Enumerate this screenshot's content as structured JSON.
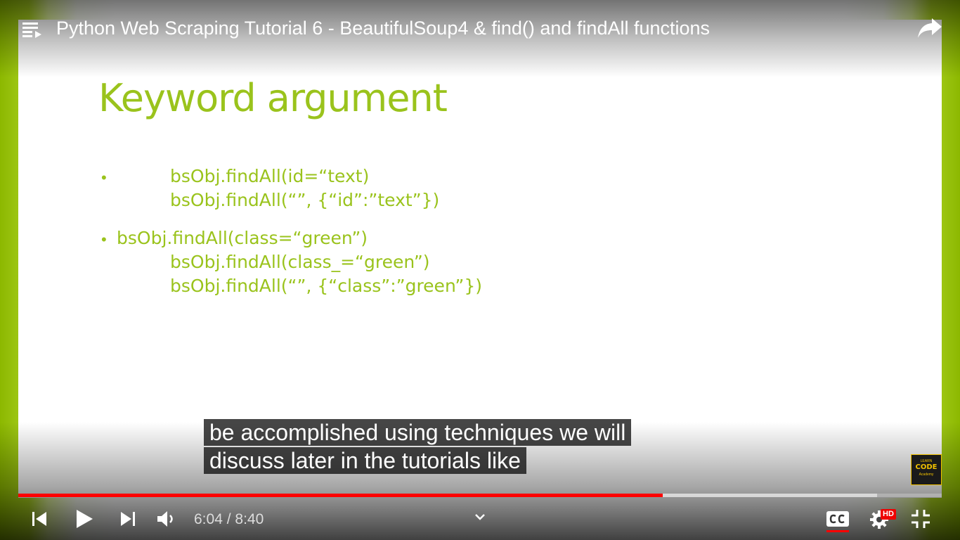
{
  "header": {
    "title": "Python Web Scraping Tutorial 6 - BeautifulSoup4 & find() and findAll functions"
  },
  "slide": {
    "heading": "Keyword argument",
    "lines": [
      "bsObj.findAll(id=“text)",
      "bsObj.findAll(“”, {“id”:”text”})",
      "bsObj.findAll(class=“green”)",
      "bsObj.findAll(class_=“green”)",
      "bsObj.findAll(“”, {“class”:”green”})"
    ],
    "bullet_char": "•",
    "text_color": "#9ac31c"
  },
  "captions": [
    "be accomplished using techniques we will",
    "discuss later in the tutorials like"
  ],
  "watermark": {
    "top": "LEARN",
    "main": "CODE",
    "bottom": "Academy"
  },
  "player": {
    "current_time": "6:04",
    "separator": " / ",
    "duration": "8:40",
    "progress_fraction": 0.698,
    "buffer_fraction": 0.93,
    "hd_badge": "HD",
    "progress_color": "#ff0000",
    "icons": [
      "playlist-icon",
      "share-icon",
      "previous-icon",
      "play-icon",
      "next-icon",
      "volume-icon",
      "chevron-down-icon",
      "captions-icon",
      "settings-icon",
      "exit-fullscreen-icon"
    ]
  }
}
